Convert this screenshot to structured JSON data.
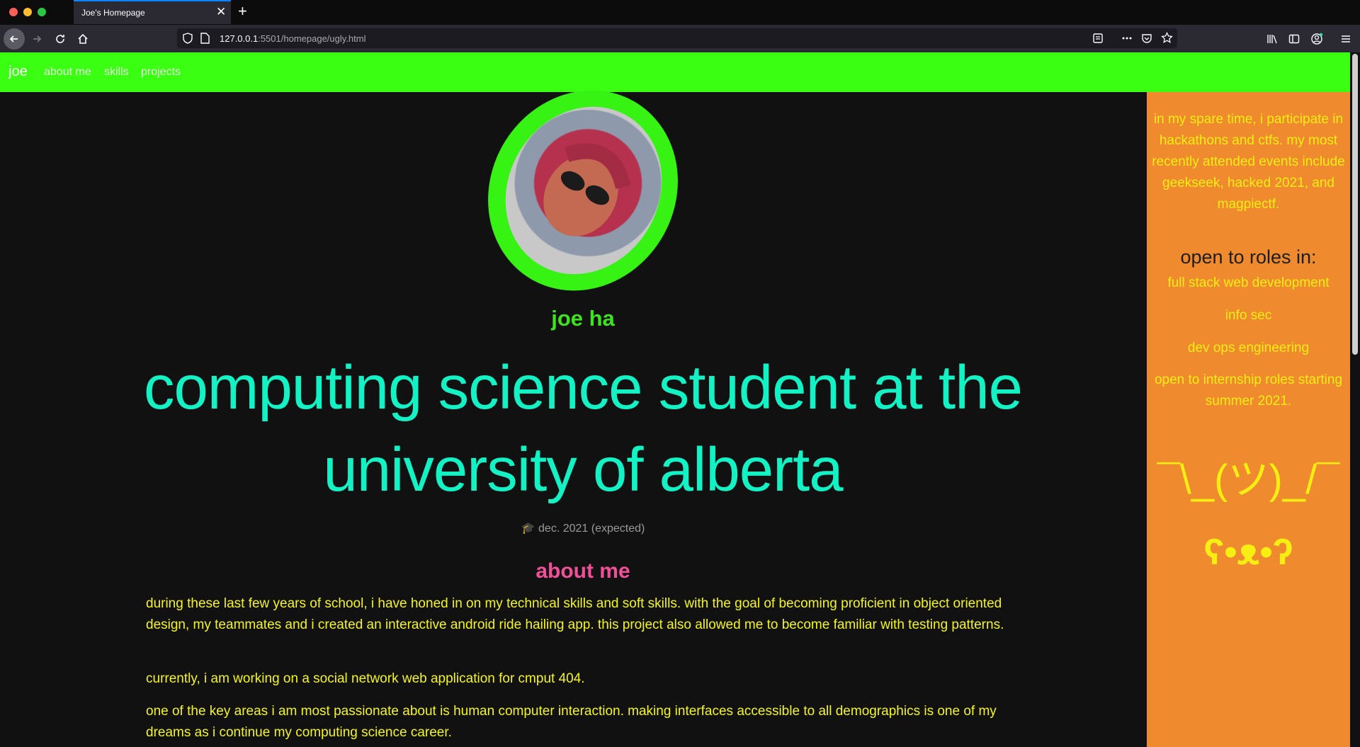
{
  "browser": {
    "tab_title": "Joe's Homepage",
    "tab_close": "✕",
    "new_tab": "+",
    "url_host": "127.0.0.1",
    "url_rest": ":5501/homepage/ugly.html"
  },
  "nav": {
    "brand": "joe",
    "links": [
      "about me",
      "skills",
      "projects"
    ]
  },
  "profile": {
    "name": "joe ha",
    "headline": "computing science student at the university of alberta",
    "graduation": "🎓 dec. 2021 (expected)"
  },
  "about": {
    "heading": "about me",
    "paragraphs": [
      "during these last few years of school, i have honed in on my technical skills and soft skills. with the goal of becoming proficient in object oriented design, my teammates and i created an interactive android ride hailing app. this project also allowed me to become familiar with testing patterns.",
      "currently, i am working on a social network web application for cmput 404.",
      "one of the key areas i am most passionate about is human computer interaction. making interfaces accessible to all demographics is one of my dreams as i continue my computing science career."
    ]
  },
  "sidebar": {
    "spare_time": "in my spare time, i participate in hackathons and ctfs. my most recently attended events include geekseek, hacked 2021, and magpiectf.",
    "roles_heading": "open to roles in:",
    "roles": [
      "full stack web development",
      "info sec",
      "dev ops engineering",
      "open to internship roles starting summer 2021."
    ],
    "shrug": "¯\\_(ツ)_/¯",
    "bear": "ʕ•ᴥ•ʔ"
  },
  "colors": {
    "nav_bg": "#3aff13",
    "sidebar_bg": "#f08a2e",
    "headline": "#12f2c5",
    "name": "#3de31d",
    "about_heading": "#f24f9a",
    "body_text": "#f4f51c"
  }
}
